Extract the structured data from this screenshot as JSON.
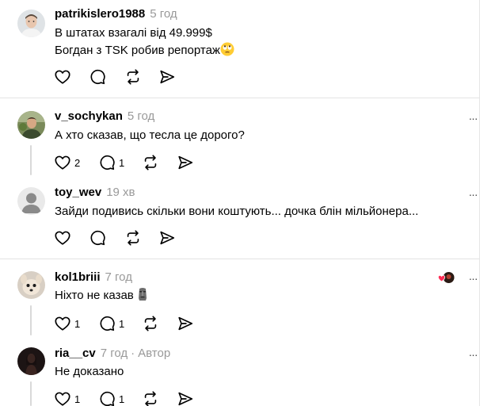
{
  "colors": {
    "muted": "#999999",
    "divider": "#e3e3e3",
    "like_red": "#ff2d55"
  },
  "posts": [
    {
      "username": "patrikislero1988",
      "time": "5 год",
      "lines": [
        "В штатах взагалі від 49.999$",
        "Богдан з TSK робив репортаж"
      ],
      "emoji": "face-with-rolling-eyes",
      "likes": "",
      "replies": ""
    },
    {
      "username": "v_sochykan",
      "time": "5 год",
      "lines": [
        "А хто сказав, що тесла це дорого?"
      ],
      "likes": "2",
      "replies": "1"
    },
    {
      "username": "toy_wev",
      "time": "19 хв",
      "lines": [
        "Зайди подивись скільки вони коштують... дочка блін мільйонера..."
      ],
      "likes": "",
      "replies": ""
    },
    {
      "username": "kol1briii",
      "time": "7 год",
      "lines": [
        "Ніхто не казав"
      ],
      "emoji": "moai",
      "likes": "1",
      "replies": "1"
    },
    {
      "username": "ria__cv",
      "time": "7 год",
      "separator": "·",
      "badge": "Автор",
      "lines": [
        "Не доказано"
      ],
      "likes": "1",
      "replies": "1"
    }
  ],
  "icons": {
    "like": "heart-icon",
    "reply": "comment-icon",
    "repost": "repost-icon",
    "share": "send-icon",
    "more": "more-icon"
  }
}
